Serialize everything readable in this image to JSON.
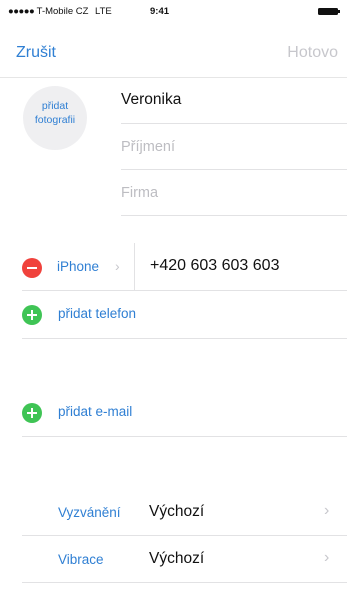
{
  "status_bar": {
    "signal_dots": "●●●●●",
    "carrier": "T-Mobile CZ",
    "network": "LTE",
    "time": "9:41",
    "battery_icon": "battery-full-icon"
  },
  "nav": {
    "cancel_label": "Zrušit",
    "done_label": "Hotovo"
  },
  "photo": {
    "line1": "přidat",
    "line2": "fotografii"
  },
  "name_fields": {
    "first_name_value": "Veronika",
    "last_name_placeholder": "Příjmení",
    "company_placeholder": "Firma"
  },
  "phone": {
    "remove_icon": "minus-circle-icon",
    "label": "iPhone",
    "chevron": "›",
    "number": "+420 603 603 603"
  },
  "add_phone": {
    "icon": "plus-circle-icon",
    "label": "přidat telefon"
  },
  "add_email": {
    "icon": "plus-circle-icon",
    "label": "přidat e-mail"
  },
  "ringtone": {
    "label": "Vyzvánění",
    "value": "Výchozí",
    "chevron": "›"
  },
  "vibration": {
    "label": "Vibrace",
    "value": "Výchozí",
    "chevron": "›"
  },
  "colors": {
    "accent": "#2f7fd3",
    "disabled": "#c7c7cc",
    "remove": "#f0423c",
    "add": "#3fc455"
  }
}
